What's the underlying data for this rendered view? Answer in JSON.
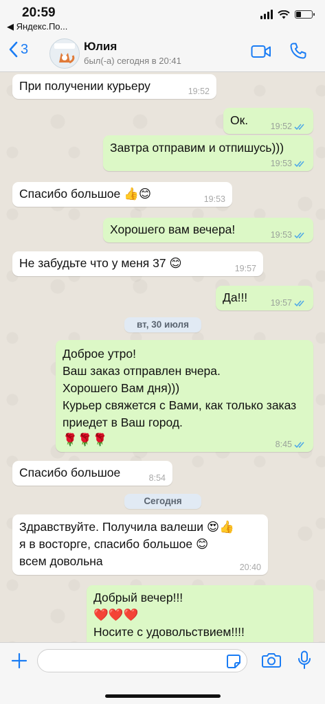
{
  "status_bar": {
    "time": "20:59",
    "back_app": "◀ Яндекс.По..."
  },
  "header": {
    "back_count": "3",
    "contact_name": "Юлия",
    "contact_status": "был(-а) сегодня в 20:41",
    "video_icon": "video-camera-icon",
    "call_icon": "phone-icon"
  },
  "colors": {
    "accent": "#1a7cf4",
    "incoming": "#ffffff",
    "outgoing": "#dcf8c6",
    "ticks": "#4fa9e6"
  },
  "messages": [
    {
      "dir": "in",
      "text": "При получении курьеру",
      "time": "19:52"
    },
    {
      "dir": "out",
      "text": "Ок.",
      "time": "19:52",
      "read": true
    },
    {
      "dir": "out",
      "text": "Завтра отправим и отпишусь)))",
      "time": "19:53",
      "read": true
    },
    {
      "dir": "in",
      "text": "Спасибо большое 👍😊",
      "time": "19:53"
    },
    {
      "dir": "out",
      "text": "Хорошего вам вечера!",
      "time": "19:53",
      "read": true
    },
    {
      "dir": "in",
      "text": "Не забудьте что у меня 37 😊",
      "time": "19:57"
    },
    {
      "dir": "out",
      "text": "Да!!!",
      "time": "19:57",
      "read": true
    },
    {
      "dir": "date",
      "text": "вт, 30 июля"
    },
    {
      "dir": "out",
      "text": "Доброе утро!\nВаш заказ отправлен вчера.\nХорошего Вам дня)))\nКурьер свяжется с Вами, как только заказ приедет в Ваш город.\n🌹🌹🌹",
      "time": "8:45",
      "read": true
    },
    {
      "dir": "in",
      "text": "Спасибо большое",
      "time": "8:54"
    },
    {
      "dir": "date",
      "text": "Сегодня"
    },
    {
      "dir": "in",
      "text": "Здравствуйте. Получила валеши 😍👍\nя в восторге, спасибо большое 😊\nвсем довольна",
      "time": "20:40"
    },
    {
      "dir": "out",
      "text": "Добрый вечер!!!\n❤️❤️❤️\nНосите с удовольствием!!!!",
      "time": ""
    }
  ],
  "input": {
    "placeholder": ""
  }
}
